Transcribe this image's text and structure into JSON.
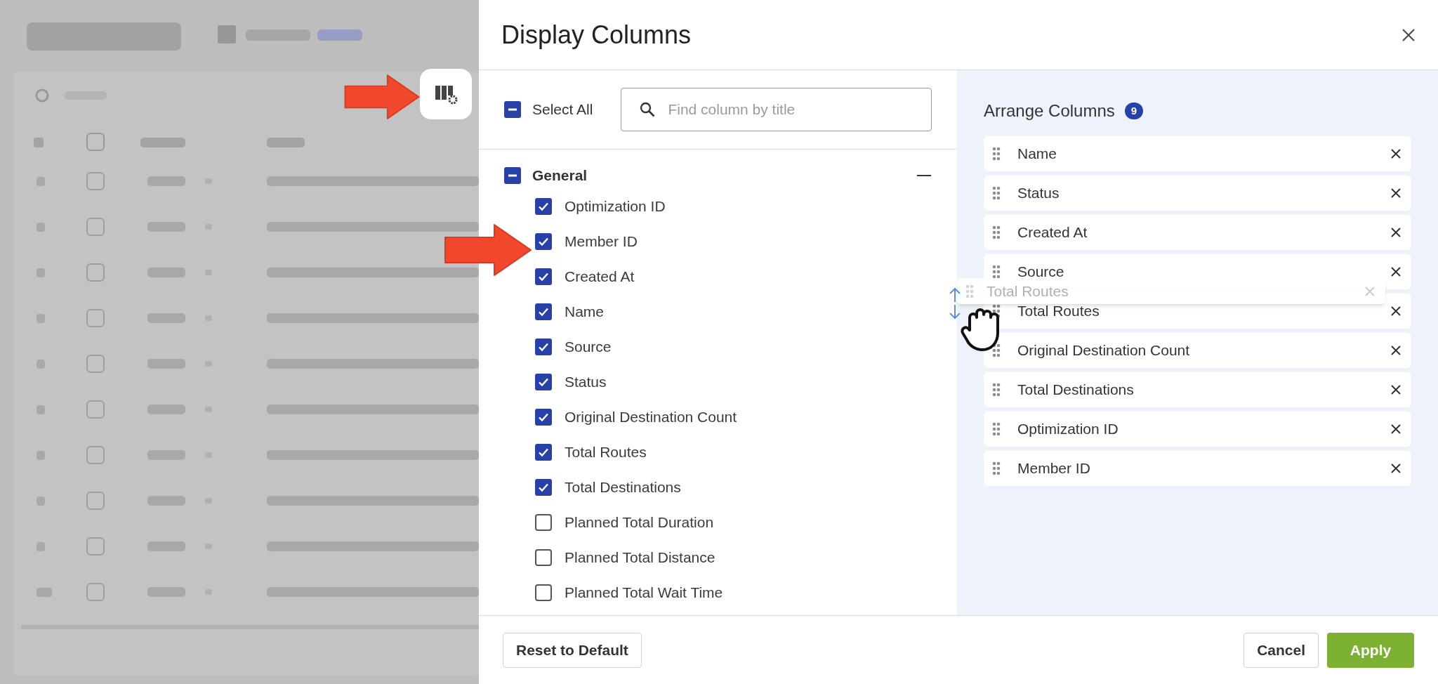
{
  "dialog": {
    "title": "Display Columns",
    "select_all": {
      "label": "Select All",
      "checked": false,
      "indeterminate": true
    },
    "search": {
      "placeholder": "Find column by title"
    },
    "groups": [
      {
        "label": "General",
        "checked": false,
        "indeterminate": true,
        "expanded": true,
        "items": [
          {
            "label": "Optimization ID",
            "checked": true
          },
          {
            "label": "Member ID",
            "checked": true
          },
          {
            "label": "Created At",
            "checked": true
          },
          {
            "label": "Name",
            "checked": true
          },
          {
            "label": "Source",
            "checked": true
          },
          {
            "label": "Status",
            "checked": true
          },
          {
            "label": "Original Destination Count",
            "checked": true
          },
          {
            "label": "Total Routes",
            "checked": true
          },
          {
            "label": "Total Destinations",
            "checked": true
          },
          {
            "label": "Planned Total Duration",
            "checked": false
          },
          {
            "label": "Planned Total Distance",
            "checked": false
          },
          {
            "label": "Planned Total Wait Time",
            "checked": false
          }
        ]
      }
    ],
    "arrange": {
      "title": "Arrange Columns",
      "count": "9",
      "items": [
        {
          "label": "Name"
        },
        {
          "label": "Status"
        },
        {
          "label": "Created At"
        },
        {
          "label": "Source"
        },
        {
          "label": "Total Routes"
        },
        {
          "label": "Original Destination Count"
        },
        {
          "label": "Total Destinations"
        },
        {
          "label": "Optimization ID"
        },
        {
          "label": "Member ID"
        }
      ],
      "dragging": {
        "label": "Total Routes"
      }
    },
    "buttons": {
      "reset": "Reset to Default",
      "cancel": "Cancel",
      "apply": "Apply"
    }
  }
}
